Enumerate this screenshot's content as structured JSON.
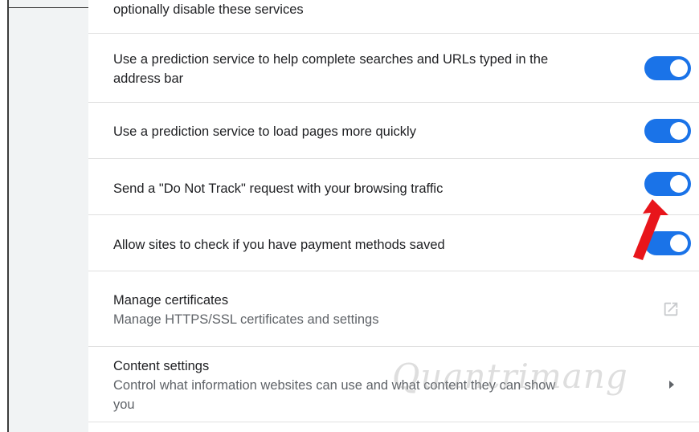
{
  "privacy": {
    "intro_tail": "optionally disable these services",
    "rows": [
      {
        "label": "Use a prediction service to help complete searches and URLs typed in the",
        "label_line2": "address bar",
        "toggle_on": true
      },
      {
        "label": "Use a prediction service to load pages more quickly",
        "toggle_on": true
      },
      {
        "label": "Send a \"Do Not Track\" request with your browsing traffic",
        "toggle_on": true
      },
      {
        "label": "Allow sites to check if you have payment methods saved",
        "toggle_on": true
      }
    ],
    "manage_certificates": {
      "title": "Manage certificates",
      "subtitle": "Manage HTTPS/SSL certificates and settings",
      "icon": "external-link-icon"
    },
    "content_settings": {
      "title": "Content settings",
      "subtitle_line1": "Control what information websites can use and what content they can show",
      "subtitle_line2": "you",
      "icon": "chevron-right-icon"
    }
  },
  "watermark": "Quantrimang",
  "colors": {
    "toggle_on": "#1a73e8",
    "annotation_arrow": "#e8151b"
  }
}
